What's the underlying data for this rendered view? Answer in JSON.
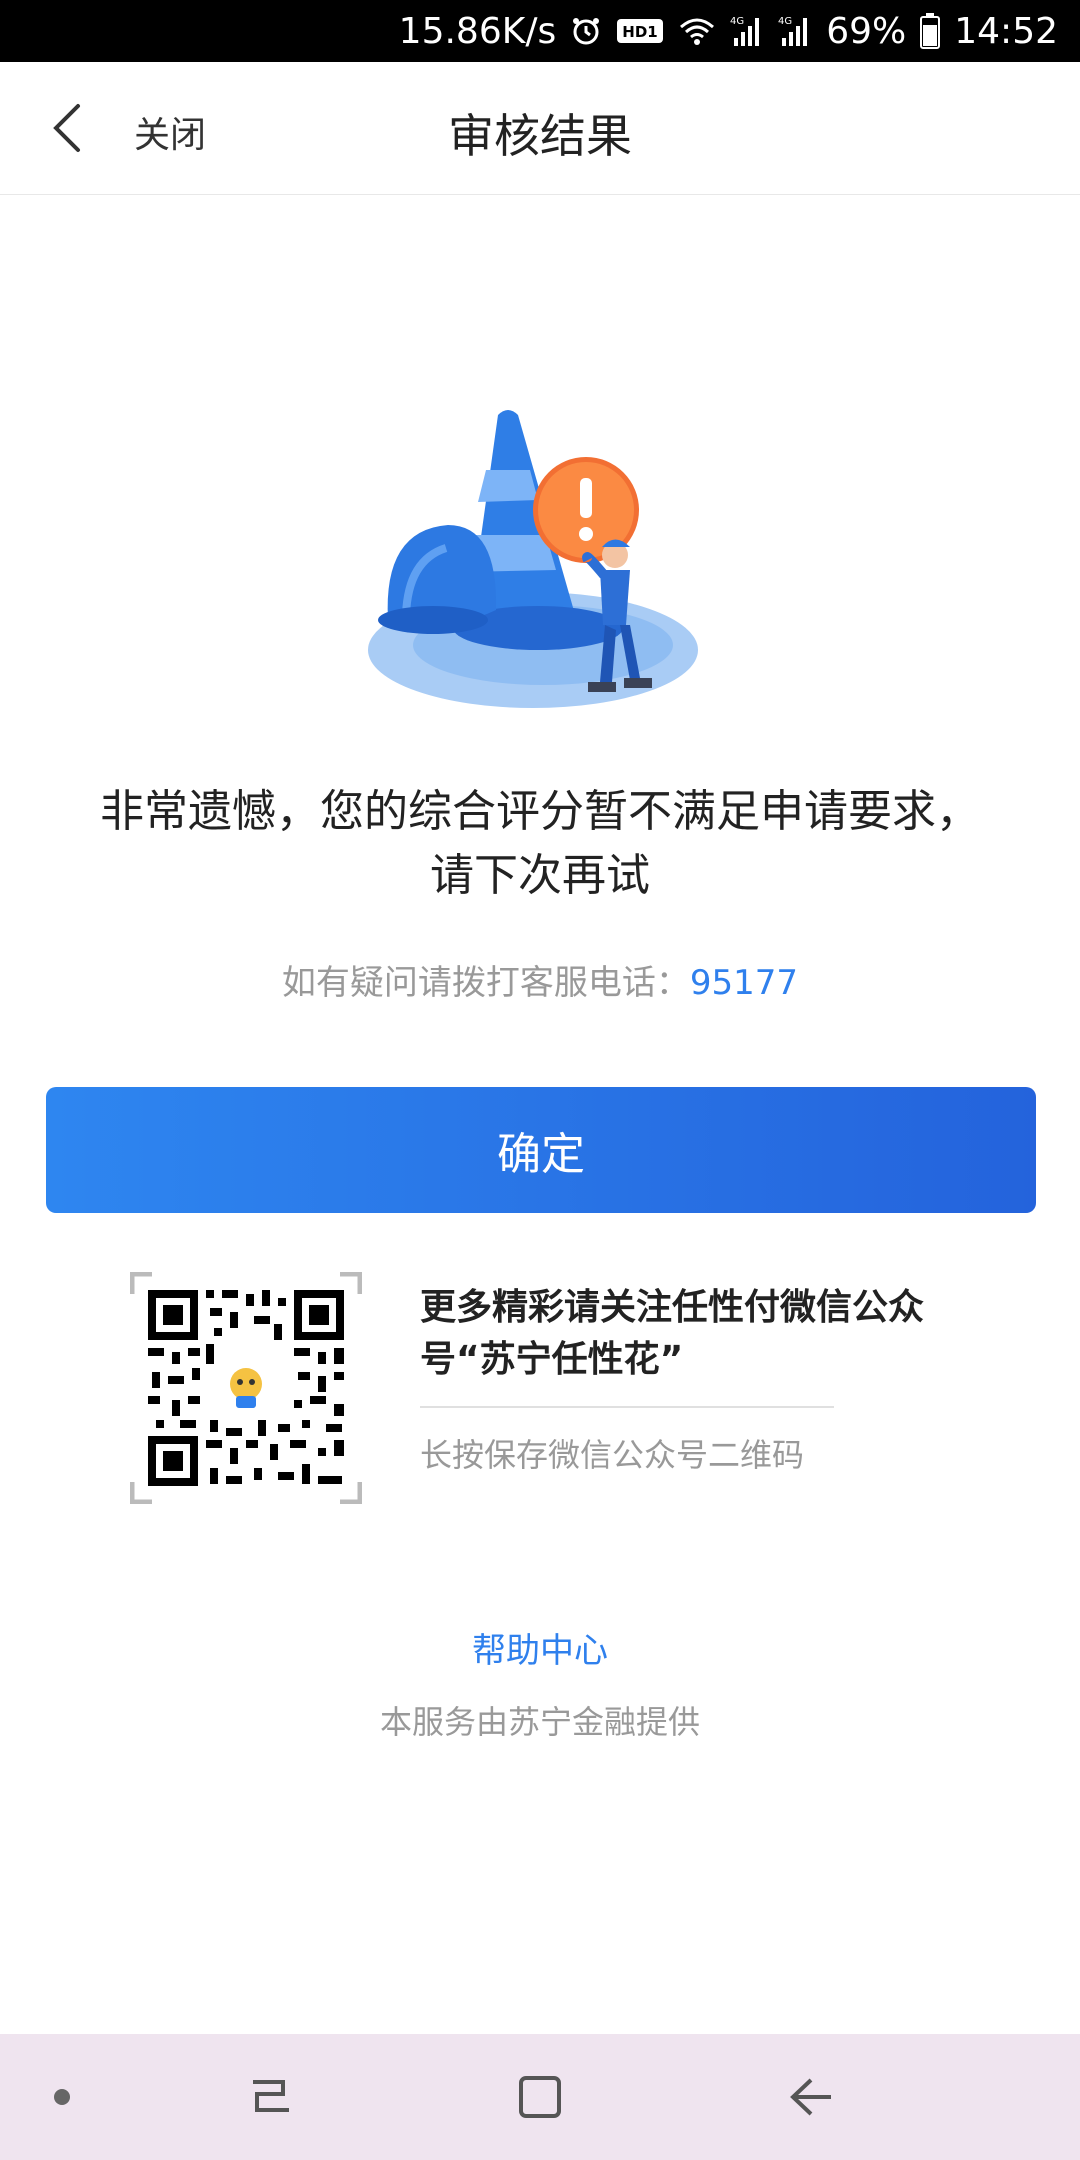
{
  "status_bar": {
    "speed": "15.86K/s",
    "hd_badge": "HD1",
    "network_1": "4G",
    "network_2": "4G",
    "battery": "69%",
    "time": "14:52",
    "icons": [
      "alarm-icon",
      "hd-icon",
      "wifi-icon",
      "signal-icon",
      "signal-icon",
      "battery-icon"
    ]
  },
  "nav": {
    "back_icon": "chevron-left-icon",
    "close_label": "关闭",
    "title": "审核结果"
  },
  "result": {
    "illustration_icon": "warning-cone-illustration",
    "message_line1": "非常遗憾，您的综合评分暂不满足申请要求，",
    "message_line2": "请下次再试",
    "phone_prefix": "如有疑问请拨打客服电话：",
    "phone_number": "95177"
  },
  "confirm_button": {
    "label": "确定"
  },
  "promo": {
    "qr_icon": "qr-code-icon",
    "title": "更多精彩请关注任性付微信公众号“苏宁任性花”",
    "subtitle": "长按保存微信公众号二维码"
  },
  "footer": {
    "help_link": "帮助中心",
    "provider": "本服务由苏宁金融提供"
  },
  "colors": {
    "accent": "#2f80ed",
    "button_start": "#2e86f0",
    "button_end": "#2463dc",
    "system_nav_bg": "#efe4ef"
  }
}
